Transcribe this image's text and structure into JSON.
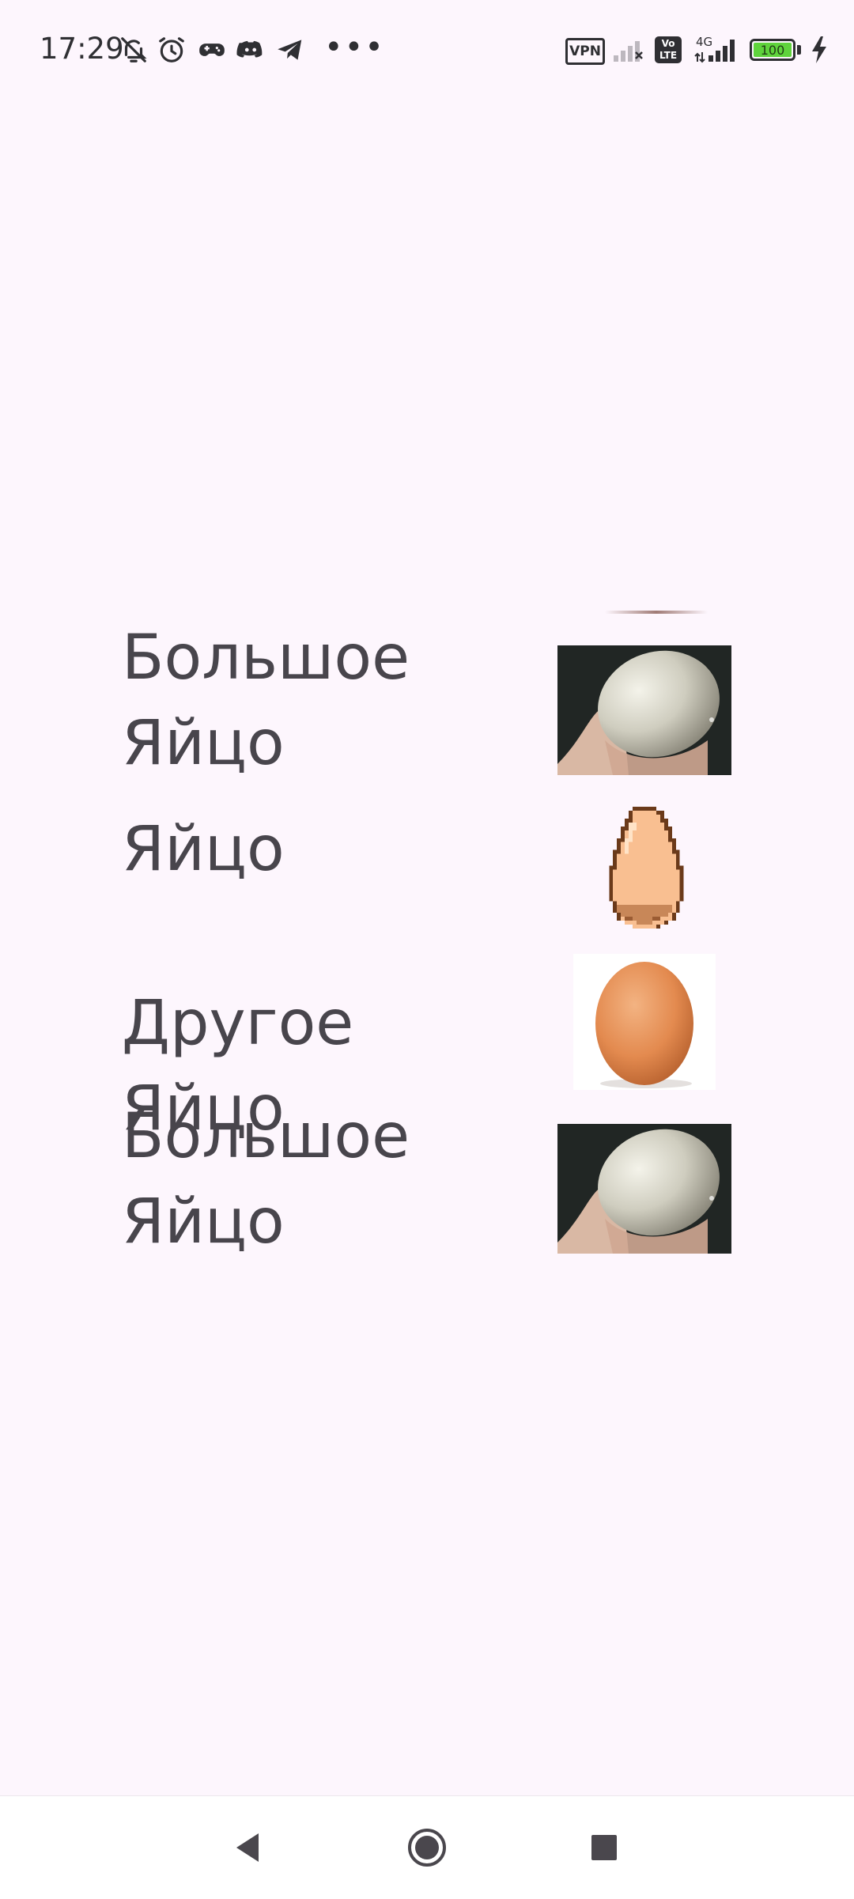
{
  "status_bar": {
    "time": "17:29",
    "left_icons": [
      "bell-off-icon",
      "alarm-icon",
      "game-controller-icon",
      "discord-icon",
      "telegram-icon"
    ],
    "overflow": "•••",
    "vpn_label": "VPN",
    "volte_label": "Vo LTE",
    "network_label": "4G",
    "battery_level": "100"
  },
  "items": [
    {
      "label": "Большое Яйцо",
      "image": "ostrich-egg-photo"
    },
    {
      "label": "Яйцо",
      "image": "pixel-egg"
    },
    {
      "label": "Другое Яйцо",
      "image": "brown-egg-photo"
    },
    {
      "label": "Большое Яйцо",
      "image": "ostrich-egg-photo"
    }
  ],
  "nav": {
    "back": "back-icon",
    "home": "home-icon",
    "recents": "recents-icon"
  },
  "colors": {
    "background": "#fdf6fd",
    "text": "#48454c",
    "battery": "#5fd33c"
  }
}
